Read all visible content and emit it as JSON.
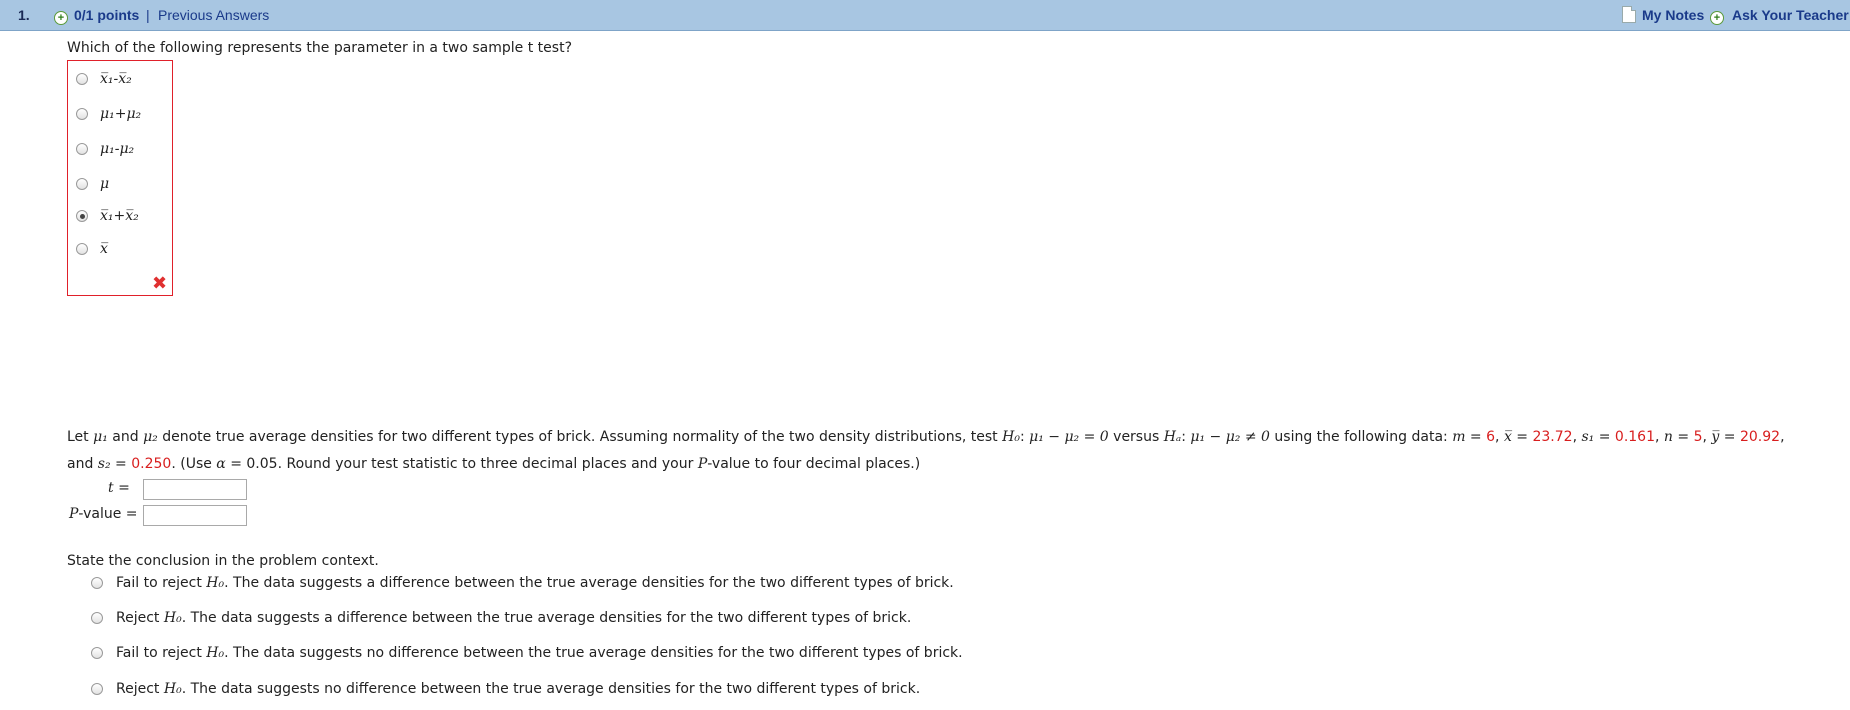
{
  "header": {
    "question_number": "1.",
    "points": "0/1 points",
    "separator": "|",
    "previous_answers": "Previous Answers",
    "my_notes": "My Notes",
    "ask_teacher": "Ask Your Teacher"
  },
  "question1": {
    "prompt": "Which of the following represents the parameter in a two sample t test?",
    "options": [
      {
        "label": "x̅₁-x̅₂",
        "selected": false
      },
      {
        "label": "μ₁+μ₂",
        "selected": false
      },
      {
        "label": "μ₁-μ₂",
        "selected": false
      },
      {
        "label": "μ",
        "selected": false
      },
      {
        "label": "x̅₁+x̅₂",
        "selected": true
      },
      {
        "label": "x̅",
        "selected": false
      }
    ],
    "result_icon": "incorrect-x-icon"
  },
  "question2": {
    "text_a": "Let ",
    "mu1": "μ₁",
    "text_b": " and ",
    "mu2": "μ₂",
    "text_c": " denote true average densities for two different types of brick. Assuming normality of the two density distributions, test ",
    "h0": "H₀",
    "text_d": ": ",
    "h0_expr": "μ₁ − μ₂ = 0",
    "text_e": " versus ",
    "ha": "Hₐ",
    "text_f": ": ",
    "ha_expr": "μ₁ − μ₂ ≠ 0",
    "text_g": " using the following data: ",
    "m_label": "m",
    "eq": " = ",
    "m_value": "6",
    "comma": ", ",
    "xbar_label": "x̅",
    "xbar_value": "23.72",
    "s1_label": "s₁",
    "s1_value": "0.161",
    "n_label": "n",
    "n_value": "5",
    "ybar_label": "y̅",
    "ybar_value": "20.92",
    "text_and": ", and ",
    "s2_label": "s₂",
    "s2_value": "0.250",
    "text_h": ". (Use ",
    "alpha": "α",
    "alpha_value": " = 0.05",
    "text_i": ". Round your test statistic to three decimal places and your ",
    "pval_word": "P",
    "text_j": "-value to four decimal places.)",
    "t_label": "t",
    "t_eq": " =",
    "t_value": "",
    "p_label": "P",
    "p_rest": "-value =",
    "p_value": ""
  },
  "question3": {
    "prompt": "State the conclusion in the problem context.",
    "options": [
      {
        "pre": "Fail to reject ",
        "h": "H₀",
        "post": ". The data suggests a difference between the true average densities for the two different types of brick.",
        "selected": false
      },
      {
        "pre": "Reject ",
        "h": "H₀",
        "post": ". The data suggests a difference between the true average densities for the two different types of brick.",
        "selected": false
      },
      {
        "pre": "Fail to reject ",
        "h": "H₀",
        "post": ". The data suggests no difference between the true average densities for the two different types of brick.",
        "selected": false
      },
      {
        "pre": "Reject ",
        "h": "H₀",
        "post": ". The data suggests no difference between the true average densities for the two different types of brick.",
        "selected": false
      }
    ]
  },
  "colors": {
    "header_bg": "#a8c6e2",
    "link": "#1a3a8a",
    "error_red": "#e0202a",
    "value_red": "#d81e1e"
  }
}
